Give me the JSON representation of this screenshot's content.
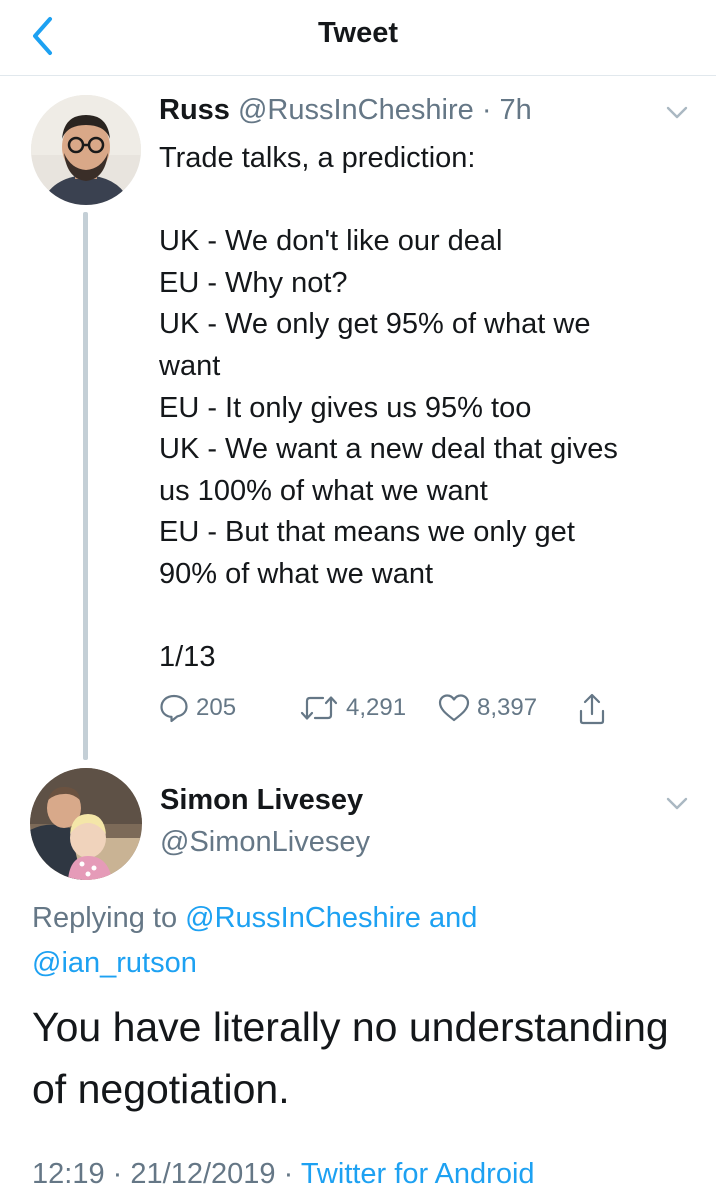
{
  "header": {
    "title": "Tweet",
    "back_icon": "chevron-left-icon",
    "accent": "#1da1f2"
  },
  "tweet": {
    "name": "Russ",
    "handle": "@RussInCheshire",
    "separator": "·",
    "age": "7h",
    "lines": [
      "Trade talks, a prediction:",
      "",
      "UK - We don't like our deal",
      "EU - Why not?",
      "UK - We only get 95% of what we",
      "want",
      "EU - It only gives us 95% too",
      "UK - We want a new deal that gives",
      "us 100% of what we want",
      "EU - But that means we only get",
      "90% of what we want",
      "",
      "1/13"
    ],
    "actions": {
      "replies": "205",
      "retweets": "4,291",
      "likes": "8,397"
    }
  },
  "reply": {
    "name": "Simon Livesey",
    "handle": "@SimonLivesey",
    "replying_prefix": "Replying to",
    "replying_user1": "@RussInCheshire",
    "replying_and": "and",
    "replying_user2": "@ian_rutson",
    "text": "You have literally no understanding of negotiation.",
    "time": "12:19",
    "dot1": "·",
    "date": "21/12/2019",
    "dot2": "·",
    "client": "Twitter for Android"
  },
  "colors": {
    "text": "#14171a",
    "muted": "#657786",
    "link": "#1da1f2",
    "divider": "#e1e8ed",
    "thread_line": "#c4cfd6"
  }
}
